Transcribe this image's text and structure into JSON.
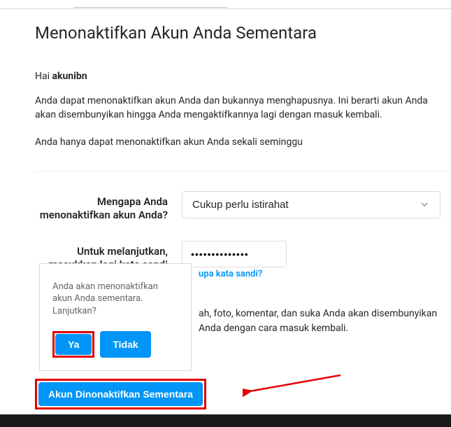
{
  "title": "Menonaktifkan Akun Anda Sementara",
  "greeting_prefix": "Hai ",
  "username": "akunibn",
  "description1": "Anda dapat menonaktifkan akun Anda dan bukannya menghapusnya. Ini berarti akun Anda akan disembunyikan hingga Anda mengaktifkannya lagi dengan masuk kembali.",
  "description2": "Anda hanya dapat menonaktifkan akun Anda sekali seminggu",
  "form": {
    "reason_label": "Mengapa Anda menonaktifkan akun Anda?",
    "reason_value": "Cukup perlu istirahat",
    "password_label": "Untuk melanjutkan, masukkan lagi kata sandi",
    "password_value": "••••••••••••••",
    "forgot_link": "upa kata sandi?"
  },
  "info_text": "ah, foto, komentar, dan suka Anda akan disembunyikan Anda dengan cara masuk kembali.",
  "popup": {
    "message": "Anda akan menonaktifkan akun Anda sementara. Lanjutkan?",
    "yes": "Ya",
    "no": "Tidak"
  },
  "primary_button": "Akun Dinonaktifkan Sementara"
}
